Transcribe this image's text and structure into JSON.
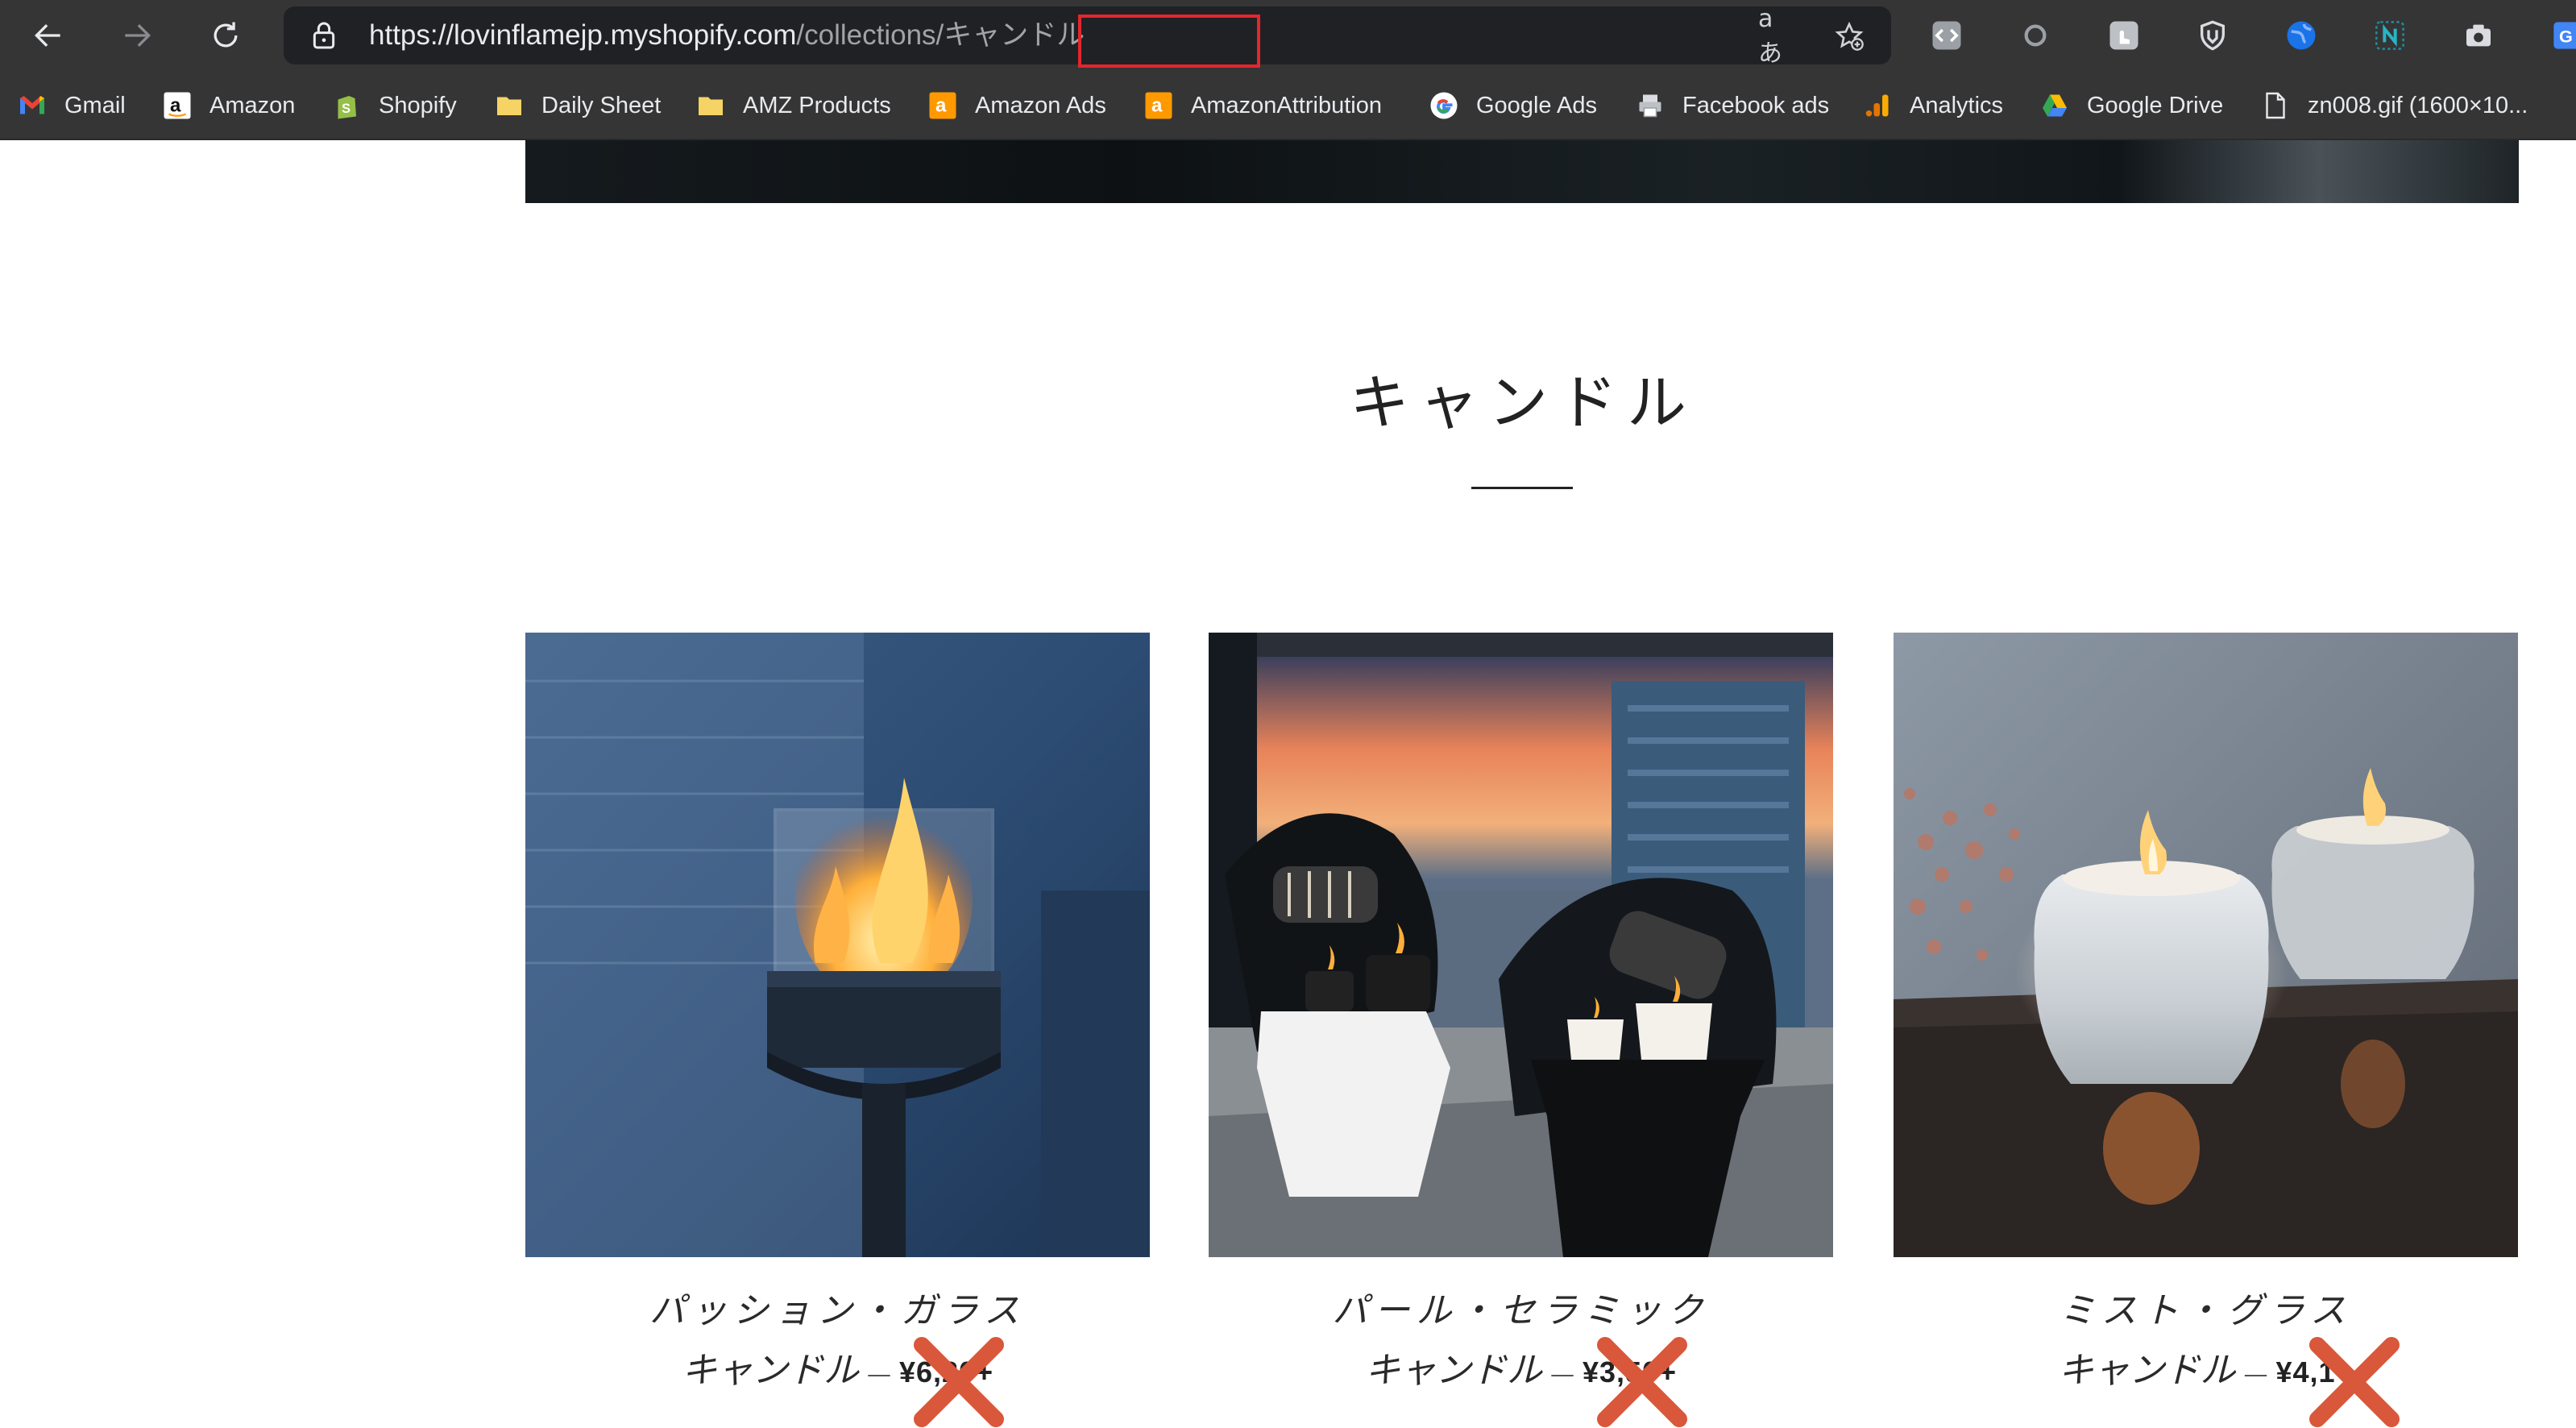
{
  "browser": {
    "url_host": "https://lovinflamejp.myshopify.com",
    "url_path": "/collections/キャンドル",
    "translate_label": "aあ",
    "colors": {
      "chrome": "#353536",
      "omnibox": "#202124",
      "highlight": "#e3262e"
    }
  },
  "bookmarks": [
    {
      "label": "Gmail",
      "icon": "gmail-icon"
    },
    {
      "label": "Amazon",
      "icon": "amazon-icon"
    },
    {
      "label": "Shopify",
      "icon": "shopify-icon"
    },
    {
      "label": "Daily Sheet",
      "icon": "folder-icon"
    },
    {
      "label": "AMZ Products",
      "icon": "folder-icon"
    },
    {
      "label": "Amazon Ads",
      "icon": "amazon-ads-icon"
    },
    {
      "label": "AmazonAttribution",
      "icon": "amazon-attribution-icon"
    },
    {
      "label": "Google Ads",
      "icon": "google-icon"
    },
    {
      "label": "Facebook ads",
      "icon": "printer-icon"
    },
    {
      "label": "Analytics",
      "icon": "analytics-icon"
    },
    {
      "label": "Google Drive",
      "icon": "google-drive-icon"
    },
    {
      "label": "zn008.gif (1600×10...",
      "icon": "file-icon"
    }
  ],
  "collection": {
    "title": "キャンドル"
  },
  "products": [
    {
      "name_line1": "パッション・ガラス",
      "name_line2": "キャンドル",
      "separator": "—",
      "price": "¥6,",
      "price_tail": "20+",
      "image": "passion-glass-candle-photo"
    },
    {
      "name_line1": "パール・セラミック",
      "name_line2": "キャンドル",
      "separator": "—",
      "price": "¥3,",
      "price_tail": "50+",
      "image": "pearl-ceramic-candle-photo"
    },
    {
      "name_line1": "ミスト・グラス",
      "name_line2": "キャンドル",
      "separator": "—",
      "price": "¥4,1",
      "price_tail": "+",
      "image": "mist-glass-candle-photo"
    }
  ],
  "annotation": {
    "mark": "red-x-mark",
    "color": "#d9573a"
  }
}
